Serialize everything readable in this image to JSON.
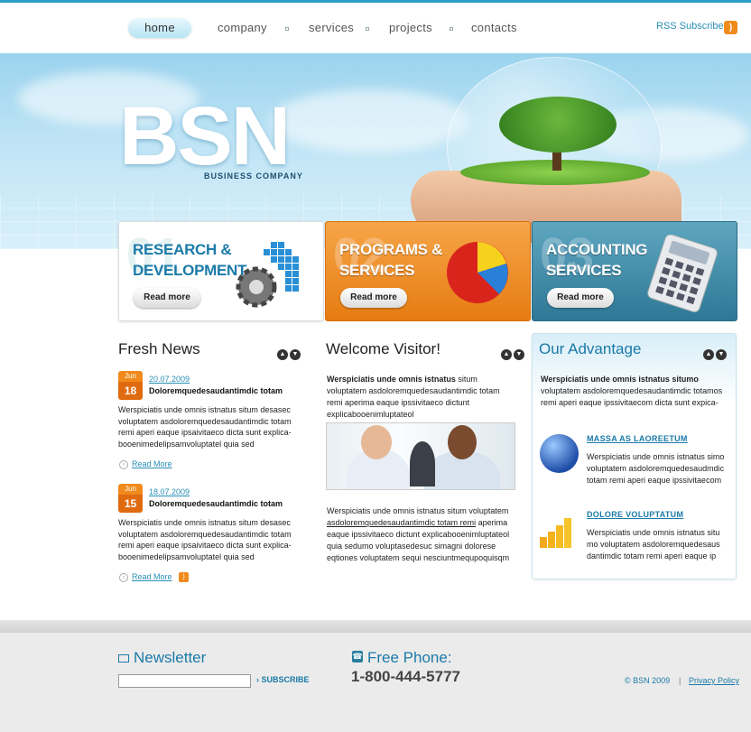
{
  "nav": {
    "items": [
      {
        "label": "home"
      },
      {
        "label": "company"
      },
      {
        "label": "services"
      },
      {
        "label": "projects"
      },
      {
        "label": "contacts"
      }
    ],
    "rss_label": "RSS Subscribe"
  },
  "hero": {
    "logo": "BSN",
    "tagline": "BUSINESS COMPANY"
  },
  "features": [
    {
      "num": "01",
      "title_line1": "RESEARCH &",
      "title_line2": "DEVELOPMENT",
      "button": "Read more"
    },
    {
      "num": "02",
      "title_line1": "PROGRAMS &",
      "title_line2": "SERVICES",
      "button": "Read more"
    },
    {
      "num": "03",
      "title_line1": "ACCOUNTING",
      "title_line2": "SERVICES",
      "button": "Read more"
    }
  ],
  "news": {
    "title": "Fresh News",
    "items": [
      {
        "month": "Jun",
        "day": "18",
        "date": "20.07.2009",
        "title": "Doloremquedesaudantimdic totam",
        "text": "Werspiciatis unde omnis istnatus situm desasec voluptatem asdoloremquedesaudantimdic totam remi aperi eaque ipsaivitaeco dicta sunt explica-booenimedelipsamvoluptatel quia sed",
        "more": "Read More"
      },
      {
        "month": "Jun",
        "day": "15",
        "date": "18.07.2009",
        "title": "Doloremquedesaudantimdic totam",
        "text": "Werspiciatis unde omnis istnatus situm desasec voluptatem asdoloremquedesaudantimdic totam remi aperi eaque ipsaivitaeco dicta sunt explica-booenimedelipsamvoluptatel quia sed",
        "more": "Read More"
      }
    ]
  },
  "welcome": {
    "title": "Welcome Visitor!",
    "p1_bold": "Werspiciatis unde omnis istnatus",
    "p1_rest": " situm voluptatem asdoloremquedesaudantimdic totam remi aperima eaque ipssivitaeco dictunt explicabooenimluptateol",
    "p2_start": "Werspiciatis unde omnis istnatus situm voluptatem ",
    "p2_link": "asdoloremquedesaudantimdic totam remi",
    "p2_rest": " aperima eaque ipssivitaeco dictunt explicabooenimluptateol quia sedumo voluptasedesuc simagni dolorese eqtiones voluptatem sequi nesciuntmequpoquisqm"
  },
  "advantage": {
    "title": "Our Advantage",
    "intro_bold": "Werspiciatis unde omnis istnatus situmo",
    "intro_rest": " voluptatem asdoloremquedesaudantimdic totamos remi aperi eaque ipssivitaecom dicta sunt expica-",
    "items": [
      {
        "link": "MASSA AS LAOREETUM",
        "text": "Werspiciatis unde omnis istnatus simo voluptatem asdoloremquedesaudmdic totam remi aperi eaque ipssivitaecom"
      },
      {
        "link": "DOLORE VOLUPTATUM",
        "text": "Werspiciatis unde omnis istnatus situ mo voluptatem asdoloremquedesaus dantimdic totam remi aperi eaque ip"
      }
    ]
  },
  "footer": {
    "newsletter_title": "Newsletter",
    "subscribe": "SUBSCRIBE",
    "phone_title": "Free Phone:",
    "phone_number": "1-800-444-5777",
    "copyright": "© BSN 2009",
    "separator": "|",
    "privacy": "Privacy Policy"
  },
  "colors": {
    "accent": "#1b7aa8",
    "orange": "#e67c12",
    "teal": "#2e7896"
  }
}
